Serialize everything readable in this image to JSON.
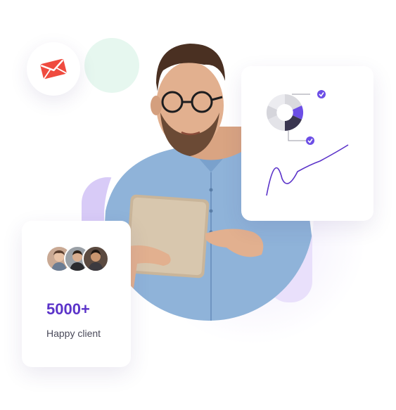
{
  "stats": {
    "count": "5000+",
    "label": "Happy client"
  },
  "icons": {
    "mail": "mail-icon",
    "check": "check-circle-icon",
    "donut": "donut-chart-icon",
    "trend": "trend-line-icon"
  },
  "colors": {
    "accent": "#5b33c9",
    "accent_light": "#6c4ee6",
    "mail_red": "#ef4b3f",
    "mint": "#e6f7ef",
    "donut_dark": "#3a3650",
    "donut_grey": "#e3e3e8",
    "shirt": "#8fb3d9"
  }
}
